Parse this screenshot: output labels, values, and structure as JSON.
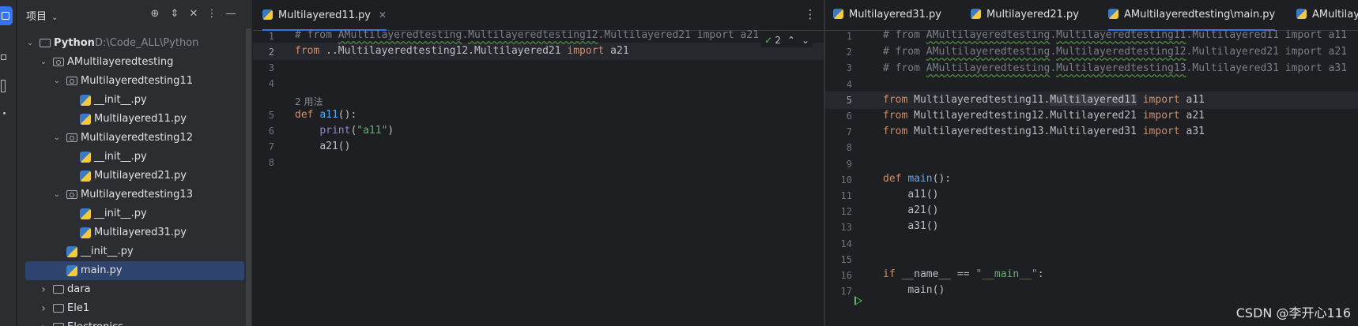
{
  "activity_bar": {
    "items": [
      "project-icon",
      "structure-icon",
      "bookmarks-icon",
      "more-icon"
    ]
  },
  "project_panel": {
    "title": "项目",
    "tree": [
      {
        "label": "Python",
        "path": "D:\\Code_ALL\\Python",
        "type": "folder",
        "depth": 0,
        "expanded": true
      },
      {
        "label": "AMultilayeredtesting",
        "type": "package",
        "depth": 1,
        "expanded": true
      },
      {
        "label": "Multilayeredtesting11",
        "type": "package",
        "depth": 2,
        "expanded": true
      },
      {
        "label": "__init__.py",
        "type": "py",
        "depth": 3
      },
      {
        "label": "Multilayered11.py",
        "type": "py",
        "depth": 3
      },
      {
        "label": "Multilayeredtesting12",
        "type": "package",
        "depth": 2,
        "expanded": true
      },
      {
        "label": "__init__.py",
        "type": "py",
        "depth": 3
      },
      {
        "label": "Multilayered21.py",
        "type": "py",
        "depth": 3
      },
      {
        "label": "Multilayeredtesting13",
        "type": "package",
        "depth": 2,
        "expanded": true
      },
      {
        "label": "__init__.py",
        "type": "py",
        "depth": 3
      },
      {
        "label": "Multilayered31.py",
        "type": "py",
        "depth": 3
      },
      {
        "label": "__init__.py",
        "type": "py",
        "depth": 2
      },
      {
        "label": "main.py",
        "type": "py",
        "depth": 2,
        "selected": true
      },
      {
        "label": "dara",
        "type": "folder",
        "depth": 1,
        "expanded": false
      },
      {
        "label": "Ele1",
        "type": "folder",
        "depth": 1,
        "expanded": false
      },
      {
        "label": "Electronics",
        "type": "folder",
        "depth": 1,
        "expanded": false
      }
    ]
  },
  "left_editor": {
    "tabs": [
      {
        "label": "Multilayered11.py",
        "active": true
      }
    ],
    "inspection": {
      "count": "2"
    },
    "usage_hint": "2 用法",
    "gutter": [
      "1",
      "2",
      "3",
      "4",
      "5",
      "6",
      "7",
      "8"
    ],
    "current_line": 2
  },
  "right_editor": {
    "tabs": [
      {
        "label": "Multilayered31.py",
        "active": false
      },
      {
        "label": "Multilayered21.py",
        "active": false
      },
      {
        "label": "AMultilayeredtesting\\main.py",
        "active": true
      },
      {
        "label": "AMultilayered",
        "active": false
      }
    ],
    "gutter": [
      "1",
      "2",
      "3",
      "4",
      "5",
      "6",
      "7",
      "8",
      "9",
      "10",
      "11",
      "12",
      "13",
      "14",
      "15",
      "16",
      "17"
    ],
    "current_line": 5
  },
  "code": {
    "left": {
      "l1_a": "# from ",
      "l1_b": "AMultilayeredtesting",
      "l1_c": ".",
      "l1_d": "Multilayeredtesting12",
      "l1_e": ".Multilayered21 import a21",
      "l2_a": "from",
      "l2_b": " ..Multilayeredtesting12.Multilayered21 ",
      "l2_c": "import",
      "l2_d": " a21",
      "l5_a": "def",
      "l5_b": "a11",
      "l5_c": "():",
      "l6_a": "print",
      "l6_b": "(",
      "l6_c": "\"a11\"",
      "l6_d": ")",
      "l7": "a21()"
    },
    "right": {
      "l1_a": "# from ",
      "l1_b": "AMultilayeredtesting",
      "l1_c": ".",
      "l1_d": "Multilayeredtesting11",
      "l1_e": ".Multilayered11 import a11",
      "l2_a": "# from ",
      "l2_b": "AMultilayeredtesting",
      "l2_c": ".",
      "l2_d": "Multilayeredtesting12",
      "l2_e": ".Multilayered21 import a21",
      "l3_a": "# from ",
      "l3_b": "AMultilayeredtesting",
      "l3_c": ".",
      "l3_d": "Multilayeredtesting13",
      "l3_e": ".Multilayered31 import a31",
      "l5_a": "from",
      "l5_b": " Multilayeredtesting11.",
      "l5_c": "Multilayered11",
      "l5_d": " ",
      "l5_e": "import",
      "l5_f": " a11",
      "l6_a": "from",
      "l6_b": " Multilayeredtesting12.Multilayered21 ",
      "l6_c": "import",
      "l6_d": " a21",
      "l7_a": "from",
      "l7_b": " Multilayeredtesting13.Multilayered31 ",
      "l7_c": "import",
      "l7_d": " a31",
      "l10_a": "def",
      "l10_b": "main",
      "l10_c": "():",
      "l11": "a11()",
      "l12": "a21()",
      "l13": "a31()",
      "l16_a": "if",
      "l16_b": " __name__ == ",
      "l16_c": "\"__main__\"",
      "l16_d": ":",
      "l17": "main()"
    }
  },
  "watermark": "CSDN @李开心116"
}
